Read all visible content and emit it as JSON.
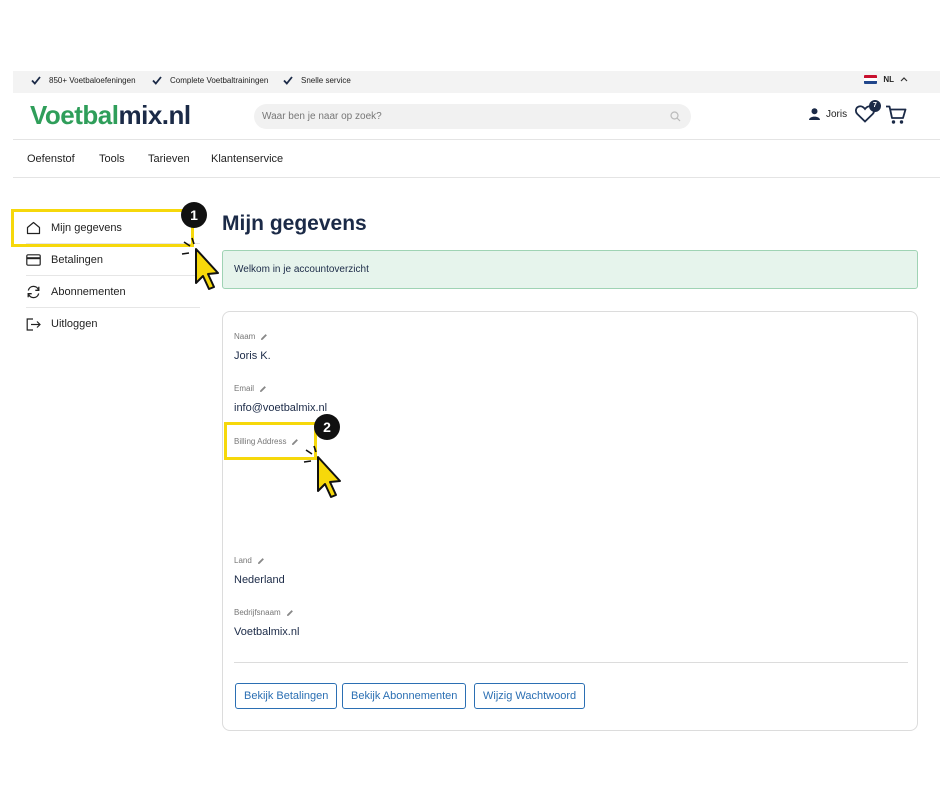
{
  "usp": [
    "850+ Voetbaloefeningen",
    "Complete Voetbaltrainingen",
    "Snelle service"
  ],
  "language": "NL",
  "logo": {
    "part1": "Voetbal",
    "part2": "mix.nl"
  },
  "search": {
    "placeholder": "Waar ben je naar op zoek?"
  },
  "user": {
    "name": "Joris"
  },
  "wishlist": {
    "count": "7"
  },
  "nav": [
    "Oefenstof",
    "Tools",
    "Tarieven",
    "Klantenservice"
  ],
  "sidebar": [
    {
      "label": "Mijn gegevens",
      "icon": "home-icon"
    },
    {
      "label": "Betalingen",
      "icon": "credit-card-icon"
    },
    {
      "label": "Abonnementen",
      "icon": "refresh-icon"
    },
    {
      "label": "Uitloggen",
      "icon": "logout-icon"
    }
  ],
  "page": {
    "title": "Mijn gegevens",
    "welcome": "Welkom in je accountoverzicht"
  },
  "fields": [
    {
      "label": "Naam",
      "value": "Joris K."
    },
    {
      "label": "Email",
      "value": "info@voetbalmix.nl"
    },
    {
      "label": "Billing Address",
      "value": ""
    },
    {
      "label": "Land",
      "value": "Nederland"
    },
    {
      "label": "Bedrijfsnaam",
      "value": "Voetbalmix.nl"
    }
  ],
  "buttons": [
    "Bekijk Betalingen",
    "Bekijk Abonnementen",
    "Wijzig Wachtwoord"
  ],
  "steps": [
    "1",
    "2"
  ],
  "colors": {
    "brand_green": "#2f9e5a",
    "brand_navy": "#1b2a47",
    "highlight": "#f6d80b",
    "button_blue": "#2b6fb3"
  }
}
